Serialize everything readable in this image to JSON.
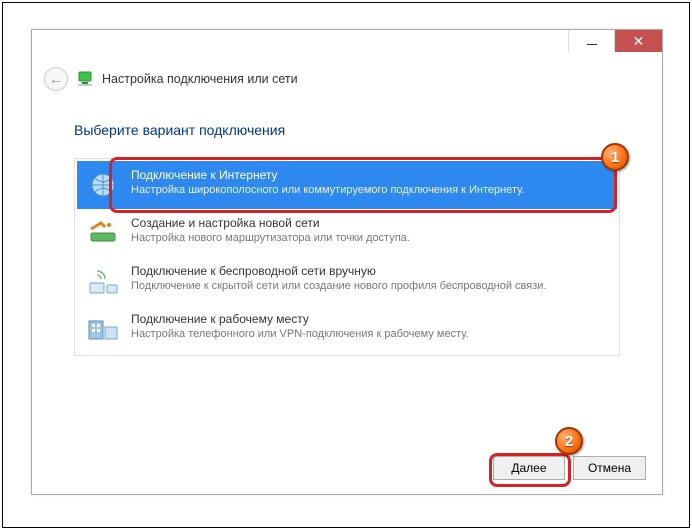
{
  "window": {
    "title": "Настройка подключения или сети"
  },
  "heading": "Выберите вариант подключения",
  "options": [
    {
      "title": "Подключение к Интернету",
      "desc": "Настройка широкополосного или коммутируемого подключения к Интернету.",
      "selected": true
    },
    {
      "title": "Создание и настройка новой сети",
      "desc": "Настройка нового маршрутизатора или точки доступа.",
      "selected": false
    },
    {
      "title": "Подключение к беспроводной сети вручную",
      "desc": "Подключение к скрытой сети или создание нового профиля беспроводной связи.",
      "selected": false
    },
    {
      "title": "Подключение к рабочему месту",
      "desc": "Настройка телефонного или VPN-подключения к рабочему месту.",
      "selected": false
    }
  ],
  "buttons": {
    "next": "Далее",
    "cancel": "Отмена"
  },
  "markers": {
    "one": "1",
    "two": "2"
  }
}
